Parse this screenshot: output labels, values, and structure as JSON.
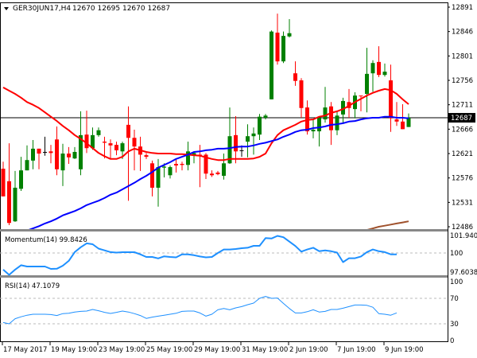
{
  "chart_data": {
    "type": "candlestick",
    "symbol_header": {
      "symbol": "GER30JUN17,H4",
      "ohlc_text": "12670 12695 12670 12687"
    },
    "price_axis": {
      "ticks": [
        12891,
        12846,
        12801,
        12756,
        12711,
        12666,
        12621,
        12576,
        12531,
        12486
      ],
      "ylim": [
        12483,
        12897
      ]
    },
    "current_price": 12687,
    "time_axis": {
      "labels": [
        "17 May 2017",
        "19 May 19:00",
        "23 May 19:00",
        "25 May 19:00",
        "29 May 19:00",
        "31 May 19:00",
        "2 Jun 19:00",
        "7 Jun 19:00",
        "9 Jun 19:00"
      ]
    },
    "colors": {
      "bull": "#008000",
      "bear": "#ff0000",
      "doji": "#000000",
      "ma_red": "#ff0000",
      "ma_blue": "#0000ff",
      "ma_brown": "#a0522d",
      "momentum": "#1e90ff",
      "rsi": "#1e90ff",
      "price_box": "#000000"
    },
    "candles_ohlc": [
      [
        12593,
        12606,
        12542,
        12542
      ],
      [
        12570,
        12640,
        12489,
        12493
      ],
      [
        12496,
        12589,
        12495,
        12558
      ],
      [
        12556,
        12615,
        12552,
        12590
      ],
      [
        12590,
        12636,
        12590,
        12609
      ],
      [
        12608,
        12646,
        12592,
        12630
      ],
      [
        12630,
        12630,
        12592,
        12621
      ],
      [
        12624,
        12652,
        12617,
        12624
      ],
      [
        12625,
        12637,
        12603,
        12622
      ],
      [
        12647,
        12671,
        12581,
        12592
      ],
      [
        12590,
        12639,
        12561,
        12621
      ],
      [
        12621,
        12633,
        12602,
        12614
      ],
      [
        12612,
        12633,
        12611,
        12624
      ],
      [
        12592,
        12699,
        12581,
        12655
      ],
      [
        12656,
        12700,
        12622,
        12631
      ],
      [
        12631,
        12669,
        12628,
        12655
      ],
      [
        12655,
        12669,
        12652,
        12664
      ],
      [
        12643,
        12652,
        12612,
        12641
      ],
      [
        12640,
        12647,
        12612,
        12636
      ],
      [
        12637,
        12643,
        12618,
        12627
      ],
      [
        12625,
        12643,
        12611,
        12640
      ],
      [
        12674,
        12708,
        12534,
        12650
      ],
      [
        12650,
        12665,
        12590,
        12634
      ],
      [
        12634,
        12652,
        12589,
        12619
      ],
      [
        12618,
        12622,
        12611,
        12615
      ],
      [
        12603,
        12608,
        12542,
        12558
      ],
      [
        12558,
        12611,
        12523,
        12596
      ],
      [
        12595,
        12603,
        12577,
        12597
      ],
      [
        12581,
        12599,
        12575,
        12596
      ],
      [
        12602,
        12611,
        12586,
        12599
      ],
      [
        12602,
        12606,
        12590,
        12600
      ],
      [
        12600,
        12643,
        12590,
        12625
      ],
      [
        12618,
        12625,
        12603,
        12622
      ],
      [
        12619,
        12637,
        12559,
        12618
      ],
      [
        12619,
        12622,
        12574,
        12584
      ],
      [
        12584,
        12590,
        12578,
        12581
      ],
      [
        12586,
        12589,
        12581,
        12583
      ],
      [
        12580,
        12621,
        12573,
        12603
      ],
      [
        12603,
        12706,
        12602,
        12653
      ],
      [
        12655,
        12690,
        12603,
        12625
      ],
      [
        12627,
        12636,
        12615,
        12627
      ],
      [
        12643,
        12675,
        12614,
        12653
      ],
      [
        12653,
        12669,
        12619,
        12658
      ],
      [
        12656,
        12694,
        12646,
        12689
      ],
      [
        12687,
        12694,
        12684,
        12691
      ],
      [
        12721,
        12848,
        12721,
        12846
      ],
      [
        12844,
        12879,
        12785,
        12791
      ],
      [
        12791,
        12846,
        12788,
        12838
      ],
      [
        12837,
        12869,
        12835,
        12843
      ],
      [
        12769,
        12791,
        12746,
        12755
      ],
      [
        12756,
        12760,
        12687,
        12705
      ],
      [
        12706,
        12719,
        12656,
        12662
      ],
      [
        12662,
        12684,
        12649,
        12665
      ],
      [
        12662,
        12690,
        12634,
        12687
      ],
      [
        12684,
        12744,
        12678,
        12706
      ],
      [
        12708,
        12716,
        12637,
        12664
      ],
      [
        12664,
        12699,
        12655,
        12691
      ],
      [
        12693,
        12724,
        12677,
        12718
      ],
      [
        12716,
        12740,
        12687,
        12705
      ],
      [
        12703,
        12734,
        12686,
        12728
      ],
      [
        12728,
        12728,
        12699,
        12727
      ],
      [
        12731,
        12816,
        12697,
        12768
      ],
      [
        12769,
        12793,
        12735,
        12788
      ],
      [
        12790,
        12819,
        12762,
        12766
      ],
      [
        12766,
        12787,
        12763,
        12772
      ],
      [
        12756,
        12785,
        12661,
        12686
      ],
      [
        12684,
        12716,
        12672,
        12680
      ],
      [
        12680,
        12712,
        12666,
        12666
      ],
      [
        12670,
        12695,
        12670,
        12687
      ]
    ],
    "ma_red": [
      12743,
      12737,
      12731,
      12724,
      12716,
      12711,
      12705,
      12697,
      12689,
      12681,
      12672,
      12664,
      12655,
      12648,
      12640,
      12631,
      12622,
      12616,
      12611,
      12611,
      12615,
      12625,
      12630,
      12627,
      12624,
      12622,
      12621,
      12621,
      12621,
      12620,
      12620,
      12619,
      12618,
      12617,
      12614,
      12611,
      12609,
      12609,
      12611,
      12611,
      12611,
      12611,
      12612,
      12615,
      12621,
      12640,
      12655,
      12664,
      12669,
      12674,
      12680,
      12683,
      12684,
      12689,
      12691,
      12696,
      12699,
      12703,
      12709,
      12716,
      12722,
      12728,
      12733,
      12737,
      12740,
      12738,
      12731,
      12721,
      12712
    ],
    "ma_blue": [
      null,
      null,
      null,
      null,
      12479,
      12483,
      12487,
      12492,
      12496,
      12501,
      12507,
      12511,
      12515,
      12520,
      12526,
      12530,
      12534,
      12539,
      12545,
      12549,
      12555,
      12561,
      12567,
      12574,
      12580,
      12587,
      12595,
      12600,
      12605,
      12611,
      12615,
      12619,
      12624,
      12625,
      12627,
      12628,
      12630,
      12630,
      12631,
      12633,
      12634,
      12634,
      12636,
      12639,
      12641,
      12644,
      12647,
      12652,
      12656,
      12661,
      12664,
      12665,
      12668,
      12669,
      12671,
      12674,
      12675,
      12677,
      12680,
      12681,
      12684,
      12686,
      12687,
      12687,
      12689,
      12689,
      12687,
      12687,
      12686
    ],
    "ma_brown": [
      null,
      null,
      null,
      null,
      null,
      null,
      null,
      null,
      null,
      null,
      null,
      null,
      null,
      null,
      null,
      null,
      null,
      null,
      null,
      null,
      null,
      null,
      null,
      null,
      null,
      null,
      null,
      null,
      null,
      null,
      null,
      null,
      null,
      null,
      null,
      null,
      null,
      null,
      null,
      null,
      null,
      null,
      null,
      null,
      null,
      null,
      null,
      null,
      null,
      null,
      null,
      null,
      null,
      null,
      null,
      null,
      null,
      null,
      null,
      null,
      null,
      12480,
      12483,
      12486,
      12488,
      12490,
      12492,
      12494,
      12496
    ],
    "momentum": {
      "label": "Momentum(14) 99.8426",
      "axis_ticks": [
        "101.9407",
        "100",
        "97.6038"
      ],
      "level": 100,
      "values": [
        98.1,
        97.5,
        98.1,
        98.6,
        98.45,
        98.45,
        98.45,
        98.45,
        98.18,
        98.2,
        98.55,
        99.1,
        100.1,
        100.65,
        101.1,
        101.0,
        100.5,
        100.3,
        100.1,
        100.05,
        100.09,
        100.09,
        100.09,
        99.85,
        99.55,
        99.55,
        99.38,
        99.62,
        99.55,
        99.5,
        99.85,
        99.85,
        99.75,
        99.6,
        99.5,
        99.55,
        100.0,
        100.4,
        100.4,
        100.45,
        100.55,
        100.6,
        100.82,
        100.82,
        101.7,
        101.65,
        101.95,
        101.8,
        101.3,
        100.8,
        100.15,
        100.4,
        100.6,
        100.2,
        100.3,
        100.2,
        100.05,
        98.95,
        99.4,
        99.4,
        99.6,
        100.1,
        100.4,
        100.2,
        100.1,
        99.85,
        99.84
      ]
    },
    "rsi": {
      "label": "RSI(14) 47.1079",
      "axis_ticks": [
        "100",
        "70",
        "30",
        "0"
      ],
      "levels": [
        70,
        30
      ],
      "values": [
        32,
        30,
        38,
        41,
        43.5,
        45,
        45,
        45,
        44.5,
        43,
        46,
        46.5,
        48.5,
        49.5,
        50,
        52.5,
        50.5,
        48,
        46.3,
        48,
        50,
        48.5,
        46,
        43,
        38.5,
        40.5,
        42,
        43.5,
        45,
        46.5,
        49.5,
        50,
        50,
        47,
        42,
        45,
        52,
        54,
        52,
        55,
        57,
        60,
        62.5,
        70,
        73,
        70,
        70.5,
        62,
        54,
        47,
        47,
        49,
        52,
        48.5,
        49.5,
        52.5,
        52.5,
        54.5,
        57,
        59.5,
        59.5,
        59,
        56,
        46,
        45,
        43.5,
        47.1
      ]
    }
  }
}
